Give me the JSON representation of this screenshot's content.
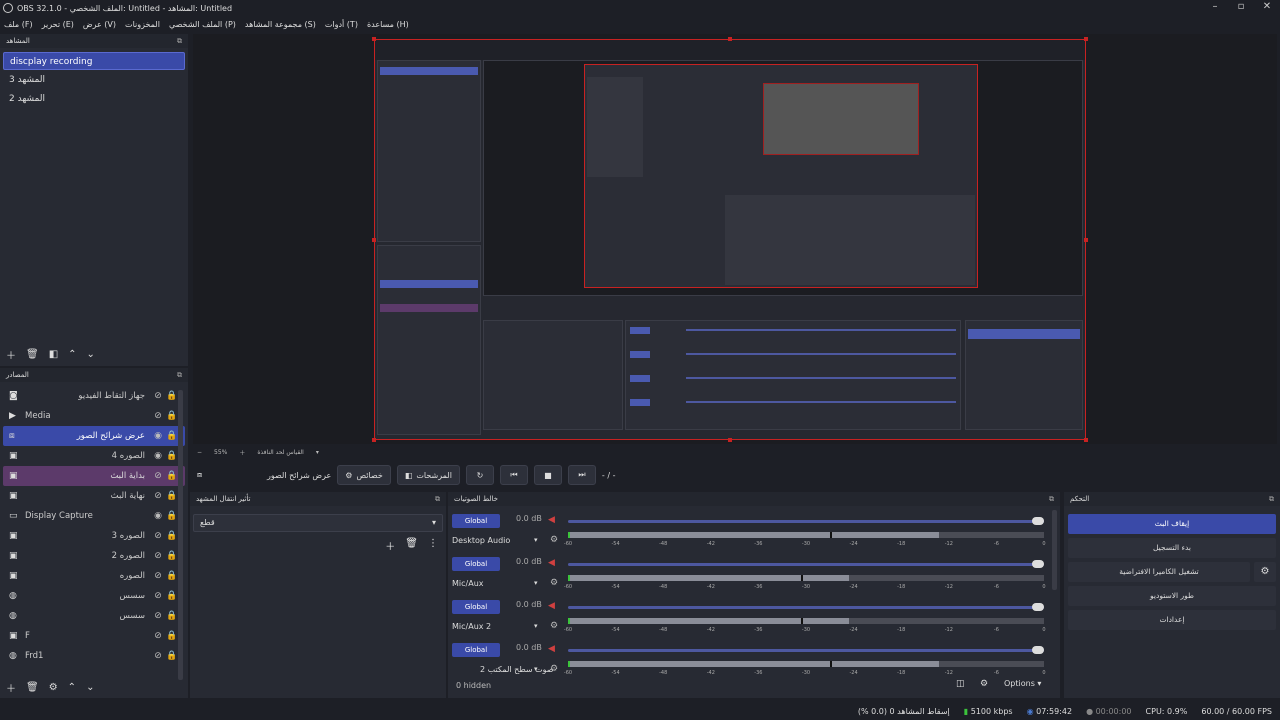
{
  "window": {
    "title": "OBS 32.1.0 - الملف الشخصي: Untitled - المشاهد: Untitled",
    "controls": [
      "–",
      "▫",
      "✕"
    ]
  },
  "menu": [
    "ملف (F)",
    "تحرير (E)",
    "عرض (V)",
    "المخزونات",
    "الملف الشخصي (P)",
    "مجموعة المشاهد (S)",
    "أدوات (T)",
    "مساعدة (H)"
  ],
  "scenes": {
    "title": "المشاهد",
    "items": [
      "discplay recording",
      "المشهد 3",
      "المشهد 2"
    ],
    "selected_index": 0
  },
  "sources": {
    "title": "المصادر",
    "items": [
      {
        "label": "جهاز التقاط الفيديو",
        "icon": "camera-icon",
        "visible": false,
        "locked": true
      },
      {
        "label": "Media",
        "icon": "play-icon",
        "visible": false,
        "locked": true
      },
      {
        "label": "عرض شرائح الصور",
        "icon": "slideshow-icon",
        "visible": true,
        "locked": true,
        "selected": true
      },
      {
        "label": "الصوره 4",
        "icon": "image-icon",
        "visible": true,
        "locked": true
      },
      {
        "label": "بداية البث",
        "icon": "image-icon",
        "visible": false,
        "locked": true,
        "group": true
      },
      {
        "label": "نهاية البث",
        "icon": "image-icon",
        "visible": false,
        "locked": true
      },
      {
        "label": "Display Capture",
        "icon": "monitor-icon",
        "visible": true,
        "locked": true
      },
      {
        "label": "الصوره 3",
        "icon": "image-icon",
        "visible": false,
        "locked": true
      },
      {
        "label": "الصوره 2",
        "icon": "image-icon",
        "visible": false,
        "locked": true
      },
      {
        "label": "الصوره",
        "icon": "image-icon",
        "visible": false,
        "locked": true
      },
      {
        "label": "سسس",
        "icon": "globe-icon",
        "visible": false,
        "locked": true
      },
      {
        "label": "سسس",
        "icon": "globe-icon",
        "visible": false,
        "locked": true
      },
      {
        "label": "F",
        "icon": "image-icon",
        "visible": false,
        "locked": true
      },
      {
        "label": "Frd1",
        "icon": "globe-icon",
        "visible": false,
        "locked": true
      }
    ]
  },
  "preview": {
    "zoom": "55%",
    "zoom_options_label": "القياس لحد النافذة"
  },
  "context": {
    "source_name": "عرض شرائح الصور",
    "properties_label": "خصائص",
    "filters_label": "المرشحات",
    "time": "- / -"
  },
  "transitions": {
    "title": "تأثير انتقال المشهد",
    "selected": "قطع"
  },
  "mixer": {
    "title": "خالط الصوتيات",
    "global_label": "Global",
    "channels": [
      {
        "name": "Desktop Audio",
        "db": "0.0 dB",
        "level": 0.78,
        "peak": 0.55
      },
      {
        "name": "Mic/Aux",
        "db": "0.0 dB",
        "level": 0.59,
        "peak": 0.49
      },
      {
        "name": "Mic/Aux 2",
        "db": "0.0 dB",
        "level": 0.59,
        "peak": 0.49
      },
      {
        "name": "صوت سطح المكتب 2",
        "db": "0.0 dB",
        "level": 0.78,
        "peak": 0.55
      }
    ],
    "ticks": [
      "-60",
      "-54",
      "-48",
      "-42",
      "-36",
      "-30",
      "-24",
      "-18",
      "-12",
      "-6",
      "0"
    ],
    "hidden_count": "0 hidden",
    "options_label": "Options"
  },
  "controls": {
    "title": "التحكم",
    "buttons": [
      "إيقاف البث",
      "بدء التسجيل",
      "تشغيل الكاميرا الافتراضية",
      "طور الاستوديو",
      "إعدادات"
    ]
  },
  "status": {
    "dropped_frames": "إسقاط المشاهد 0 (0.0 %)",
    "bitrate": "5100 kbps",
    "stream_time": "07:59:42",
    "record_time": "00:00:00",
    "cpu": "CPU: 0.9%",
    "fps": "60.00 / 60.00 FPS"
  },
  "colors": {
    "accent": "#3a4aa8",
    "selection_border": "#c82222",
    "group": "#5c3a6a"
  }
}
